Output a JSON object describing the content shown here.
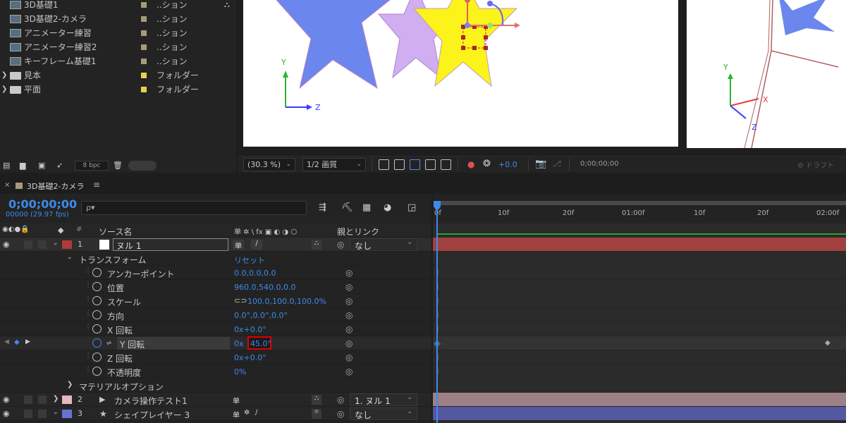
{
  "project": {
    "items": [
      {
        "name": "3D基礎1",
        "type": "..ション",
        "kind": "comp"
      },
      {
        "name": "3D基礎2-カメラ",
        "type": "..ション",
        "kind": "comp"
      },
      {
        "name": "アニメーター練習",
        "type": "..ション",
        "kind": "comp"
      },
      {
        "name": "アニメーター練習2",
        "type": "..ション",
        "kind": "comp"
      },
      {
        "name": "キーフレーム基礎1",
        "type": "..ション",
        "kind": "comp"
      },
      {
        "name": "見本",
        "type": "フォルダー",
        "kind": "folder"
      },
      {
        "name": "平面",
        "type": "フォルダー",
        "kind": "folder"
      }
    ],
    "bpc": "8 bpc",
    "comp_color": "#a89a78",
    "folder_color": "#e6d24a"
  },
  "viewer": {
    "zoom": "(30.3 %)",
    "resolution": "1/2 画質",
    "exposure": "+0.0",
    "timecode": "0;00;00;00",
    "draft": "ドラフト",
    "left_axis": {
      "y": "Y",
      "z": "Z"
    },
    "right_axis": {
      "y": "Y",
      "x": "X",
      "z": "Z"
    }
  },
  "timeline": {
    "tab_title": "3D基礎2-カメラ",
    "timecode": "0;00;00;00",
    "frames": "00000 (29.97 fps)",
    "search_placeholder": "ρ▾",
    "col_source": "ソース名",
    "col_parent": "親とリンク",
    "switch_header": "单 ✲ \\ fx ▣ ◐ ◑ ⬡",
    "ruler": [
      "0f",
      "10f",
      "20f",
      "01:00f",
      "10f",
      "20f",
      "02:00f"
    ],
    "layer1": {
      "num": "1",
      "name": "ヌル 1",
      "parent": "なし"
    },
    "transform": {
      "label": "トランスフォーム",
      "reset": "リセット"
    },
    "props": [
      {
        "name": "アンカーポイント",
        "value": "0.0,0.0,0.0"
      },
      {
        "name": "位置",
        "value": "960.0,540.0,0.0"
      },
      {
        "name": "スケール",
        "value": "100.0,100.0,100.0%"
      },
      {
        "name": "方向",
        "value": "0.0°,0.0°,0.0°"
      },
      {
        "name": "X 回転",
        "value": "0x+0.0°"
      },
      {
        "name": "Y 回転",
        "value_prefix": "0x",
        "value": "45.0°"
      },
      {
        "name": "Z 回転",
        "value": "0x+0.0°"
      },
      {
        "name": "不透明度",
        "value": "0%"
      }
    ],
    "material": "マテリアルオプション",
    "layer2": {
      "num": "2",
      "name": "カメラ操作テスト1",
      "parent": "1. ヌル 1"
    },
    "layer3": {
      "num": "3",
      "name": "シェイプレイヤー 3",
      "parent": "なし"
    },
    "layer_colors": {
      "layer1": "#b03a3a",
      "layer2": "#e6b8c1",
      "layer3": "#6a72d0"
    }
  }
}
